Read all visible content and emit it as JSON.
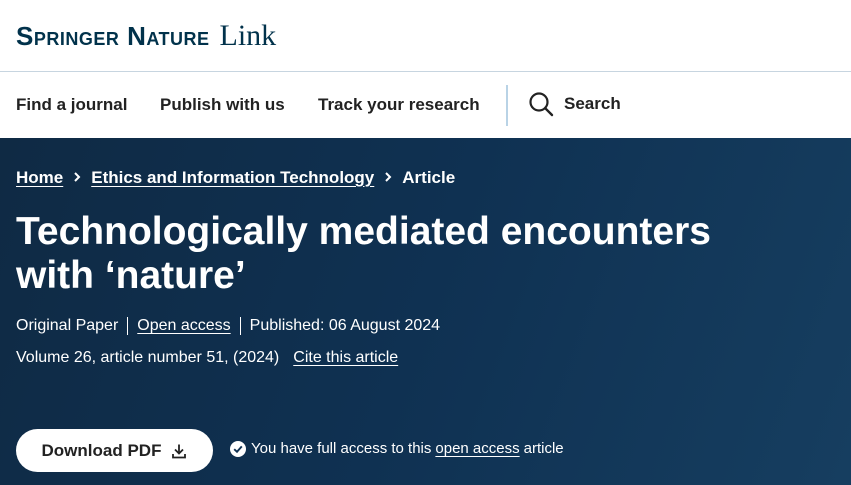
{
  "header": {
    "logo_brand": "Springer Nature",
    "logo_link": "Link"
  },
  "nav": {
    "find_journal": "Find a journal",
    "publish": "Publish with us",
    "track": "Track your research",
    "search_label": "Search"
  },
  "breadcrumb": {
    "home": "Home",
    "journal": "Ethics and Information Technology",
    "current": "Article"
  },
  "article": {
    "title": "Technologically mediated encounters with ‘nature’",
    "type": "Original Paper",
    "open_access": "Open access",
    "published": "Published: 06 August 2024",
    "volume": "Volume 26, article number 51, (2024)",
    "cite": "Cite this article"
  },
  "actions": {
    "download_pdf": "Download PDF",
    "access_prefix": "You have full access to this",
    "access_link": "open access",
    "access_suffix": "article"
  },
  "colors": {
    "brand": "#01324b",
    "hero_bg": "#0f3152",
    "divider": "#b9d3e6"
  },
  "icons": [
    "chevron-right-icon",
    "search-icon",
    "download-icon",
    "check-circle-icon"
  ]
}
